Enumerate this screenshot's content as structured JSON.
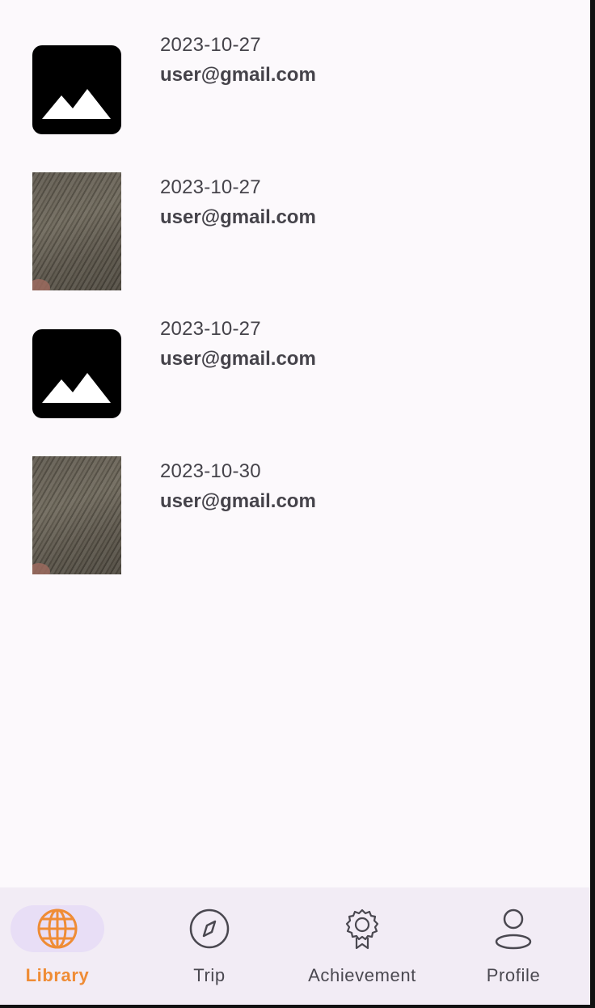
{
  "library": {
    "items": [
      {
        "date": "2023-10-27",
        "email": "user@gmail.com",
        "thumbnail": "image-placeholder-icon"
      },
      {
        "date": "2023-10-27",
        "email": "user@gmail.com",
        "thumbnail": "photo"
      },
      {
        "date": "2023-10-27",
        "email": "user@gmail.com",
        "thumbnail": "image-placeholder-icon"
      },
      {
        "date": "2023-10-30",
        "email": "user@gmail.com",
        "thumbnail": "photo"
      }
    ]
  },
  "nav": {
    "items": [
      {
        "label": "Library",
        "icon": "globe-icon",
        "active": true
      },
      {
        "label": "Trip",
        "icon": "compass-icon",
        "active": false
      },
      {
        "label": "Achievement",
        "icon": "badge-icon",
        "active": false
      },
      {
        "label": "Profile",
        "icon": "person-icon",
        "active": false
      }
    ]
  },
  "colors": {
    "background": "#fcf9fc",
    "nav_background": "#f2ecf5",
    "active_pill": "#e8def6",
    "accent": "#ef8c35",
    "text": "#45434a"
  }
}
